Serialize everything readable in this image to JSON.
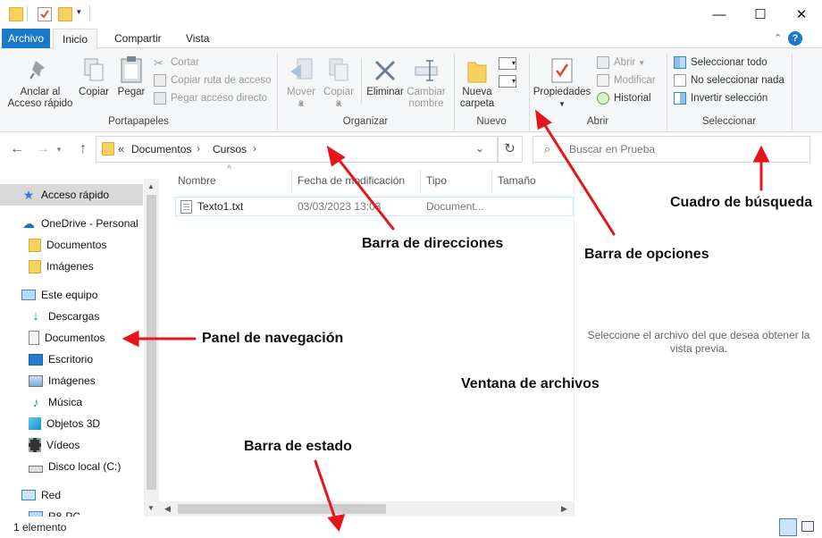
{
  "ribbon_tabs": [
    "Archivo",
    "Inicio",
    "Compartir",
    "Vista"
  ],
  "groups": {
    "portapapeles": {
      "label": "Portapapeles",
      "anclar": "Anclar al Acceso rápido",
      "copiar": "Copiar",
      "pegar": "Pegar",
      "cortar": "Cortar",
      "copiar_ruta": "Copiar ruta de acceso",
      "pegar_acceso": "Pegar acceso directo"
    },
    "organizar": {
      "label": "Organizar",
      "mover": "Mover a",
      "copiar": "Copiar a",
      "eliminar": "Eliminar",
      "cambiar": "Cambiar nombre"
    },
    "nuevo": {
      "label": "Nuevo",
      "nueva_carpeta": "Nueva carpeta"
    },
    "abrir": {
      "label": "Abrir",
      "propiedades": "Propiedades",
      "abrir": "Abrir",
      "modificar": "Modificar",
      "historial": "Historial"
    },
    "seleccionar": {
      "label": "Seleccionar",
      "todo": "Seleccionar todo",
      "nada": "No seleccionar nada",
      "invertir": "Invertir selección"
    }
  },
  "address": {
    "prefix": "«",
    "crumbs": [
      "Documentos",
      "Cursos"
    ],
    "search_placeholder": "Buscar en Prueba"
  },
  "nav_items": [
    {
      "label": "Acceso rápido",
      "icon": "star-icon",
      "indent": 1,
      "selected": true
    },
    {
      "label": "OneDrive - Personal",
      "icon": "cloud-icon",
      "indent": 1
    },
    {
      "label": "Documentos",
      "icon": "folder-icon",
      "indent": 2
    },
    {
      "label": "Imágenes",
      "icon": "folder-icon",
      "indent": 2
    },
    {
      "label": "Este equipo",
      "icon": "computer-icon",
      "indent": 1
    },
    {
      "label": "Descargas",
      "icon": "download-icon",
      "indent": 2
    },
    {
      "label": "Documentos",
      "icon": "document-icon",
      "indent": 2
    },
    {
      "label": "Escritorio",
      "icon": "desktop-icon",
      "indent": 2
    },
    {
      "label": "Imágenes",
      "icon": "pictures-icon",
      "indent": 2
    },
    {
      "label": "Música",
      "icon": "music-icon",
      "indent": 2
    },
    {
      "label": "Objetos 3D",
      "icon": "cube-icon",
      "indent": 2
    },
    {
      "label": "Vídeos",
      "icon": "video-icon",
      "indent": 2
    },
    {
      "label": "Disco local (C:)",
      "icon": "drive-icon",
      "indent": 2
    },
    {
      "label": "Red",
      "icon": "network-icon",
      "indent": 1
    },
    {
      "label": "R8-PC",
      "icon": "pc-icon",
      "indent": 2
    }
  ],
  "columns": [
    "Nombre",
    "Fecha de modificación",
    "Tipo",
    "Tamaño"
  ],
  "files": [
    {
      "name": "Texto1.txt",
      "date": "03/03/2023 13:03",
      "type": "Document..."
    }
  ],
  "preview_text": "Seleccione el archivo del que desea obtener la vista previa.",
  "status": "1 elemento",
  "annotations": {
    "address_bar": "Barra de direcciones",
    "options_bar": "Barra de opciones",
    "search_box": "Cuadro de búsqueda",
    "nav_panel": "Panel de navegación",
    "files_window": "Ventana de archivos",
    "status_bar": "Barra de estado"
  },
  "colors": {
    "file_tab": "#1979ca",
    "arrow": "#e8141b",
    "folder": "#f6d160"
  }
}
